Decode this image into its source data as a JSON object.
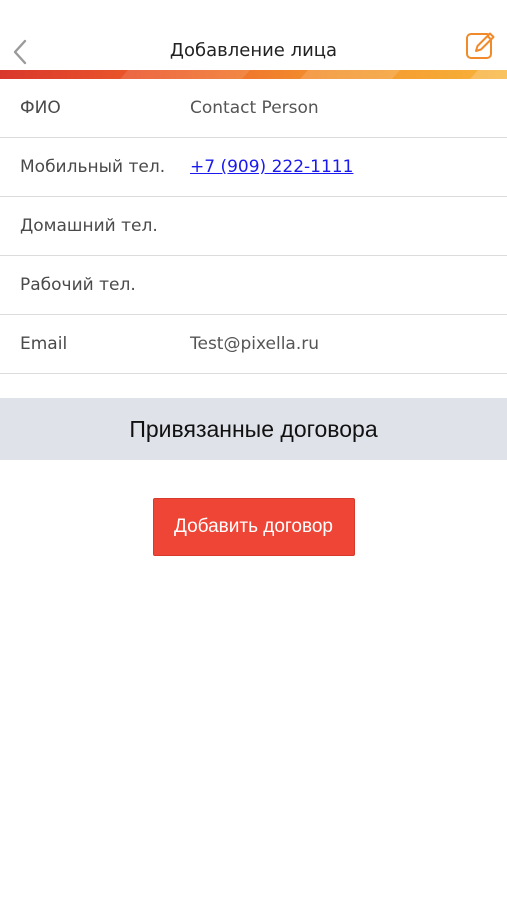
{
  "header": {
    "title": "Добавление лица",
    "back_icon": "chevron-left-icon",
    "edit_icon": "edit-pencil-icon",
    "accent": "#f08a2b"
  },
  "fields": [
    {
      "label": "ФИО",
      "value": "Contact Person"
    },
    {
      "label": "Мобильный тел.",
      "value": "+7 (909) 222-1111"
    },
    {
      "label": "Домашний тел.",
      "value": ""
    },
    {
      "label": "Рабочий тел.",
      "value": ""
    },
    {
      "label": "Email",
      "value": "Test@pixella.ru"
    }
  ],
  "contracts": {
    "section_title": "Привязанные договора",
    "add_button_label": "Добавить договор",
    "button_color": "#ef4536"
  }
}
